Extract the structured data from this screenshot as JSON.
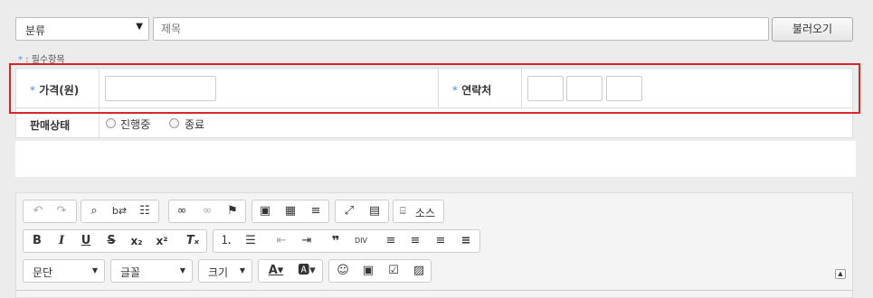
{
  "top": {
    "category": {
      "label": "분류"
    },
    "title": {
      "value": "",
      "placeholder": "제목"
    },
    "load_button": "불러오기"
  },
  "required_note": {
    "star": "*",
    "text": ": 필수항목"
  },
  "form": {
    "price_label": "가격(원)",
    "contact_label": "연락처",
    "sale_status_label": "판매상태",
    "sale_options": [
      "진행중",
      "종료"
    ]
  },
  "editor": {
    "source_label": "소스",
    "format_label": "문단",
    "font_label": "글꼴",
    "size_label": "크기"
  },
  "colors": {
    "highlight": "#d9242b",
    "required_star": "#4a90d9"
  }
}
